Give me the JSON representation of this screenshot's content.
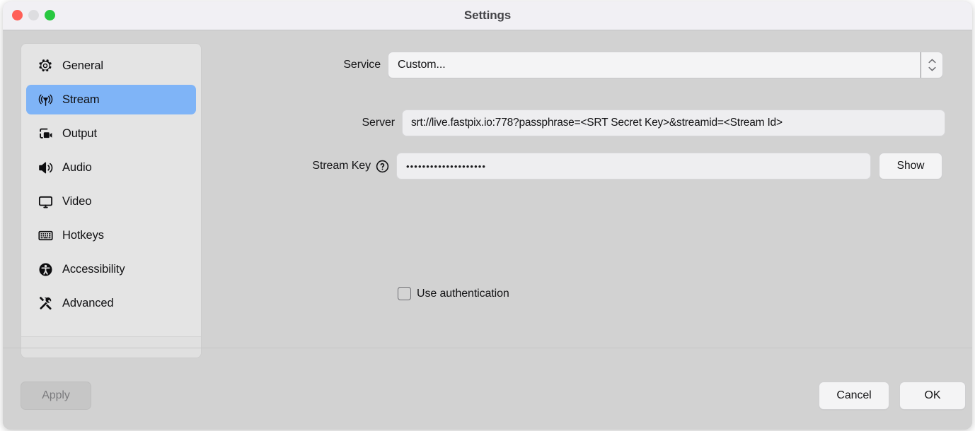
{
  "window": {
    "title": "Settings",
    "traffic_lights": [
      {
        "name": "close",
        "color": "#ff5f57"
      },
      {
        "name": "minimize",
        "color": "#dddde0"
      },
      {
        "name": "zoom",
        "color": "#28c840"
      }
    ]
  },
  "sidebar": {
    "selected": "Stream",
    "selected_color": "#7fb4f7",
    "items": [
      {
        "label": "General",
        "icon": "gear-icon"
      },
      {
        "label": "Stream",
        "icon": "broadcast-icon"
      },
      {
        "label": "Output",
        "icon": "video-camera-icon"
      },
      {
        "label": "Audio",
        "icon": "speaker-icon"
      },
      {
        "label": "Video",
        "icon": "monitor-icon"
      },
      {
        "label": "Hotkeys",
        "icon": "keyboard-icon"
      },
      {
        "label": "Accessibility",
        "icon": "accessibility-icon"
      },
      {
        "label": "Advanced",
        "icon": "tools-icon"
      }
    ]
  },
  "form": {
    "service": {
      "label": "Service",
      "value": "Custom...",
      "options": [
        "Custom..."
      ]
    },
    "server": {
      "label": "Server",
      "value": "srt://live.fastpix.io:778?passphrase=<SRT Secret Key>&streamid=<Stream Id>",
      "placeholder": ""
    },
    "stream_key": {
      "label": "Stream Key",
      "help_icon": "question-mark-circle-icon",
      "value": "••••••••••••••••••••",
      "placeholder": "",
      "show_button": "Show"
    },
    "use_authentication": {
      "label": "Use authentication",
      "checked": false
    }
  },
  "footer": {
    "apply": "Apply",
    "apply_disabled": true,
    "cancel": "Cancel",
    "ok": "OK"
  }
}
